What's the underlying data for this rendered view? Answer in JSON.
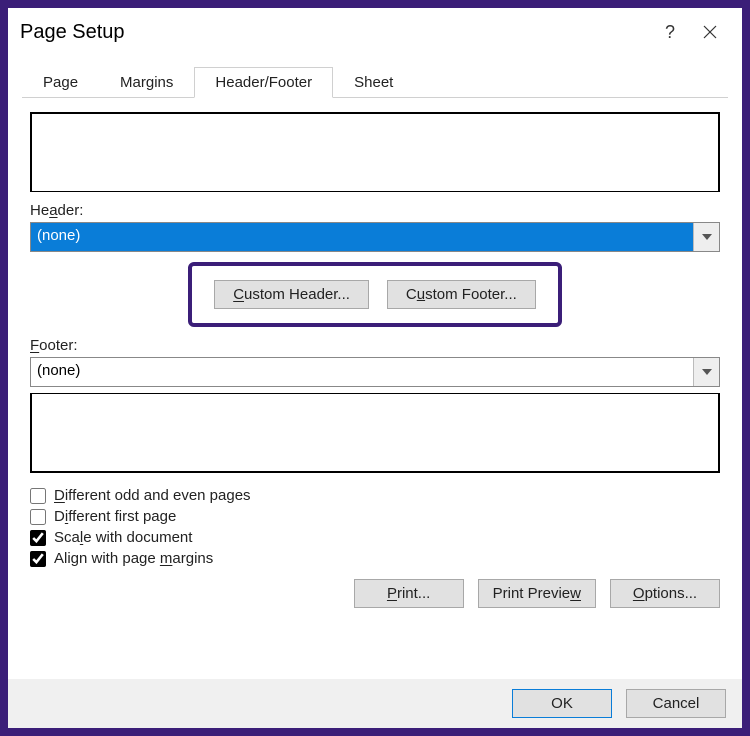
{
  "titlebar": {
    "title": "Page Setup",
    "help": "?",
    "close": "✕"
  },
  "tabs": {
    "page": "Page",
    "margins": "Margins",
    "headerfooter": "Header/Footer",
    "sheet": "Sheet"
  },
  "header": {
    "label_pre": "He",
    "label_u": "a",
    "label_post": "der:",
    "value": "(none)"
  },
  "footer": {
    "label_u": "F",
    "label_post": "ooter:",
    "value": "(none)"
  },
  "custom": {
    "header_u": "C",
    "header_post": "ustom Header...",
    "footer_u": "C",
    "footer_post": "ustom Footer..."
  },
  "checks": {
    "diff_oe_u": "D",
    "diff_oe_post": "ifferent odd and even pages",
    "diff_first_pre": "D",
    "diff_first_u": "i",
    "diff_first_post": "fferent first page",
    "scale_u": "L",
    "scale_pre": "Sca",
    "scale_mid": "l",
    "scale_post": "e with document",
    "align_pre": "Align with page ",
    "align_u": "m",
    "align_post": "argins"
  },
  "actions": {
    "print_u": "P",
    "print_post": "rint...",
    "preview_pre": "Print Previe",
    "preview_u": "w",
    "options_u": "O",
    "options_post": "ptions..."
  },
  "footerbar": {
    "ok": "OK",
    "cancel": "Cancel"
  }
}
